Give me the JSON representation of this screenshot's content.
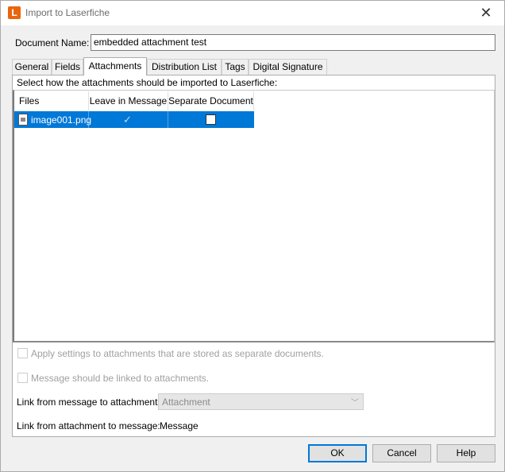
{
  "window": {
    "title": "Import to Laserfiche",
    "app_icon_letter": "L",
    "close_glyph": "✕",
    "icon": "laserfiche-app-icon"
  },
  "document": {
    "label": "Document Name:",
    "value": "embedded attachment test"
  },
  "tabs": [
    {
      "label": "General",
      "active": false
    },
    {
      "label": "Fields",
      "active": false
    },
    {
      "label": "Attachments",
      "active": true
    },
    {
      "label": "Distribution List",
      "active": false
    },
    {
      "label": "Tags",
      "active": false
    },
    {
      "label": "Digital Signature",
      "active": false
    }
  ],
  "attachments": {
    "instructions": "Select how the attachments should be imported to Laserfiche:",
    "columns": [
      "Files",
      "Leave in Message",
      "Separate Document"
    ],
    "rows": [
      {
        "file": "image001.png",
        "leave_in_message": true,
        "separate_document": false,
        "selected": true
      }
    ],
    "selection_color": "#0078d7"
  },
  "options": {
    "apply_settings_label": "Apply settings to attachments that are stored as separate documents.",
    "linked_label": "Message should be linked to attachments.",
    "link_msg_to_att_label": "Link from message to attachment:",
    "link_msg_to_att_value": "Attachment",
    "link_att_to_msg_label": "Link from attachment to message:",
    "link_att_to_msg_value": "Message"
  },
  "buttons": {
    "ok": "OK",
    "cancel": "Cancel",
    "help": "Help"
  }
}
